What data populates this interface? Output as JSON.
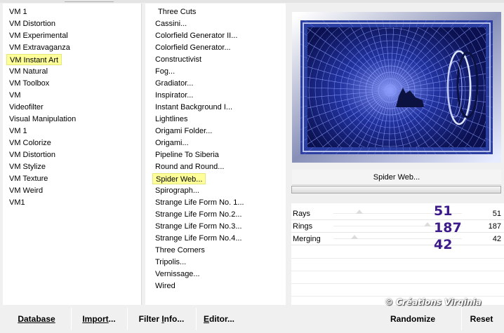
{
  "categories": [
    "VM 1",
    "VM Distortion",
    "VM Experimental",
    "VM Extravaganza",
    "VM Instant Art",
    "VM Natural",
    "VM Toolbox",
    "VM",
    "Videofilter",
    "Visual Manipulation",
    "VM 1",
    "VM Colorize",
    "VM Distortion",
    "VM Stylize",
    "VM Texture",
    "VM Weird",
    "VM1"
  ],
  "categories_selected_index": 4,
  "filters": [
    "Three Cuts",
    "Cassini...",
    "Colorfield Generator II...",
    "Colorfield Generator...",
    "Constructivist",
    "Fog...",
    "Gradiator...",
    "Inspirator...",
    "Instant Background I...",
    "Lightlines",
    "Origami Folder...",
    "Origami...",
    "Pipeline To Siberia",
    "Round and Round...",
    "Spider Web...",
    "Spirograph...",
    "Strange Life Form No. 1...",
    "Strange Life Form No.2...",
    "Strange Life Form No.3...",
    "Strange Life Form No.4...",
    "Three Corners",
    "Tripolis...",
    "Vernissage...",
    "Wired"
  ],
  "filters_selected_index": 14,
  "filter_name": "Spider Web...",
  "params": [
    {
      "name": "Rays",
      "value": "51",
      "level": 51
    },
    {
      "name": "Rings",
      "value": "187",
      "level": 187
    },
    {
      "name": "Merging",
      "value": "42",
      "level": 42
    }
  ],
  "annotations": [
    "51",
    "187",
    "42"
  ],
  "watermark": "© Créations Virginia",
  "buttons": {
    "database_u": "D",
    "database_rest": "atabase",
    "import_u": "I",
    "import_mid": "mport",
    "import_rest": "...",
    "filter_info_head": "Filter ",
    "filter_info_u": "I",
    "filter_info_rest": "nfo...",
    "editor_u": "E",
    "editor_rest": "ditor...",
    "randomize": "Randomize",
    "reset": "Reset"
  },
  "colors": {
    "highlight": "#ffff99",
    "annotation": "#3d1b8a",
    "preview_blue": "#2b3ea2"
  }
}
